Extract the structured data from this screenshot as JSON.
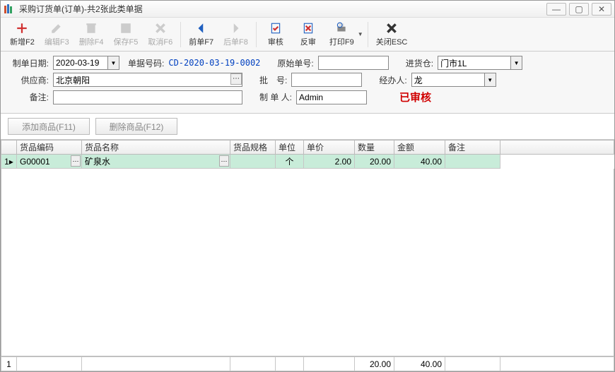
{
  "window": {
    "title": "采购订货单(订单)-共2张此类单据"
  },
  "toolbar": {
    "new": "新增F2",
    "edit": "编辑F3",
    "delete": "删除F4",
    "save": "保存F5",
    "cancel": "取消F6",
    "prev": "前单F7",
    "next": "后单F8",
    "audit": "审核",
    "unaudit": "反审",
    "print": "打印F9",
    "close": "关闭ESC"
  },
  "form": {
    "date_label": "制单日期:",
    "date_value": "2020-03-19",
    "docno_label": "单据号码:",
    "docno_value": "CD-2020-03-19-0002",
    "origno_label": "原始单号:",
    "origno_value": "",
    "whs_label": "进货仓:",
    "whs_value": "门市1L",
    "supplier_label": "供应商:",
    "supplier_value": "北京朝阳",
    "batch_label": "批　号:",
    "batch_value": "",
    "handler_label": "经办人:",
    "handler_value": "龙",
    "remark_label": "备注:",
    "remark_value": "",
    "maker_label": "制 单 人:",
    "maker_value": "Admin",
    "status": "已审核"
  },
  "buttons": {
    "add_item": "添加商品(F11)",
    "del_item": "删除商品(F12)"
  },
  "grid": {
    "headers": {
      "code": "货品编码",
      "name": "货品名称",
      "spec": "货品规格",
      "unit": "单位",
      "price": "单价",
      "qty": "数量",
      "amount": "金额",
      "remark": "备注"
    },
    "rows": [
      {
        "idx": "1",
        "code": "G00001",
        "name": "矿泉水",
        "spec": "",
        "unit": "个",
        "price": "2.00",
        "qty": "20.00",
        "amount": "40.00",
        "remark": ""
      }
    ],
    "footer": {
      "idx": "1",
      "qty": "20.00",
      "amount": "40.00"
    }
  }
}
